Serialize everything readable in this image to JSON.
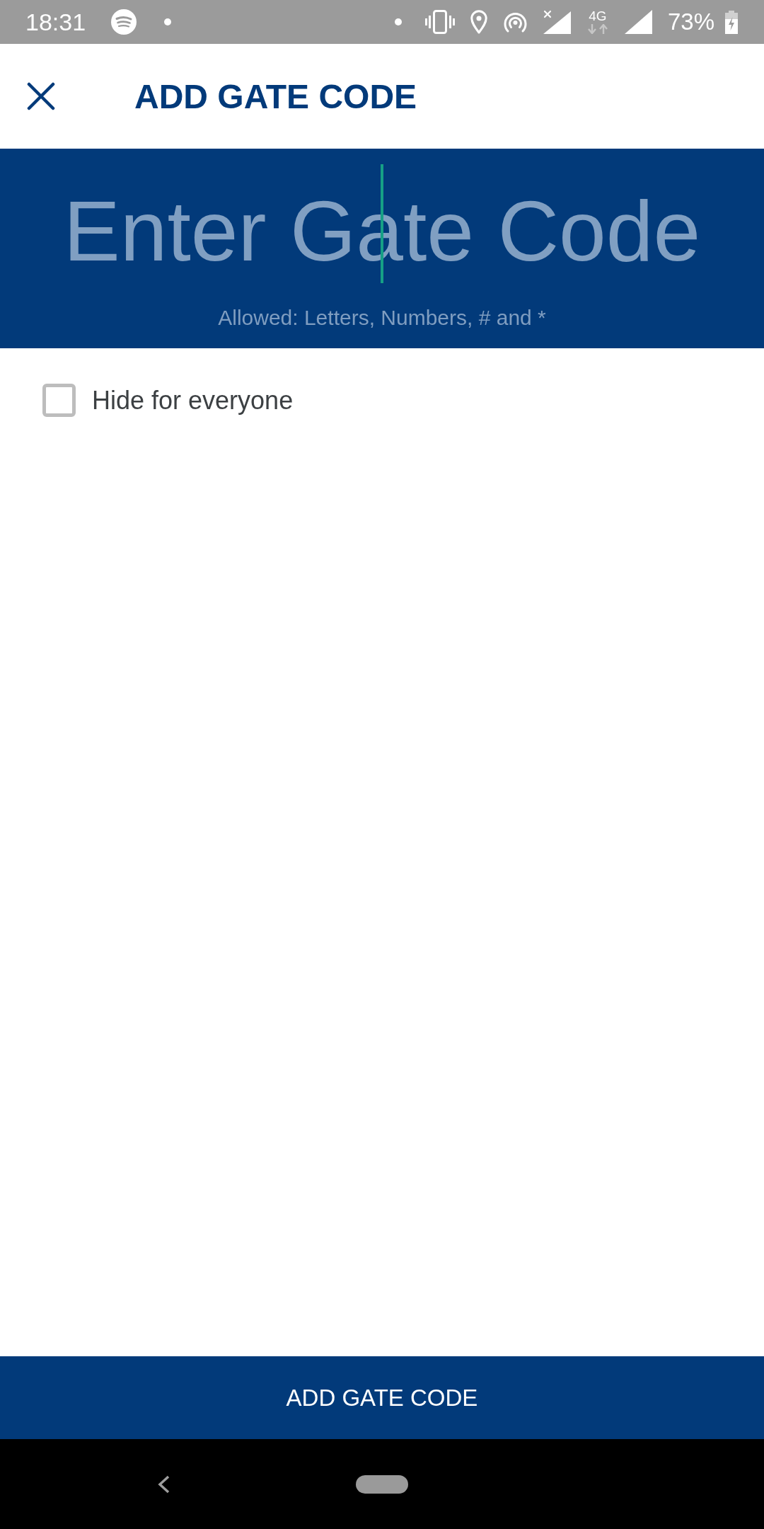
{
  "status_bar": {
    "time": "18:31",
    "network_type": "4G",
    "battery_percent": "73%"
  },
  "header": {
    "title": "ADD GATE CODE"
  },
  "gate_code_input": {
    "placeholder": "Enter Gate Code",
    "hint": "Allowed: Letters, Numbers, # and *"
  },
  "options": [
    {
      "kind": "checkbox",
      "label": "Hide for everyone",
      "checked": false
    }
  ],
  "primary_button": {
    "label": "ADD GATE CODE"
  }
}
